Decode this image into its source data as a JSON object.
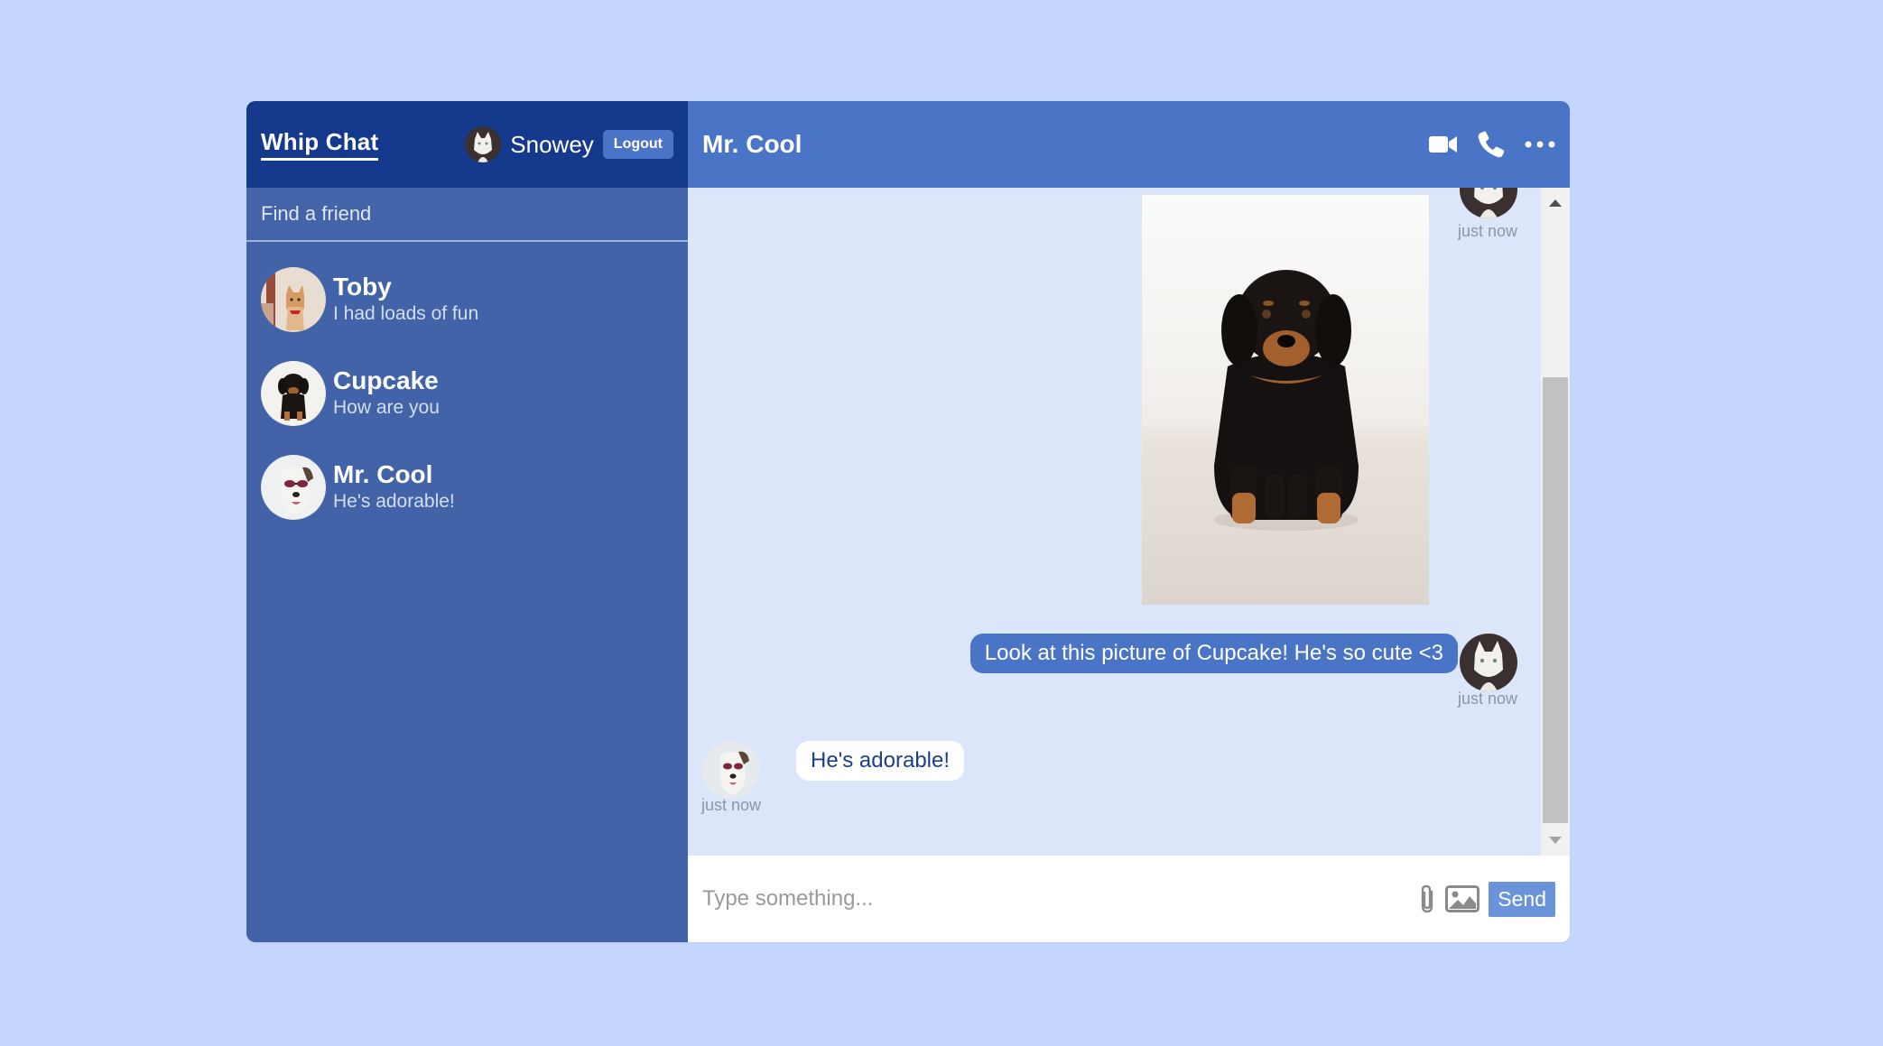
{
  "app": {
    "brand": "Whip Chat"
  },
  "user": {
    "name": "Snowey",
    "logout_label": "Logout"
  },
  "search": {
    "placeholder": "Find a friend"
  },
  "friends": [
    {
      "name": "Toby",
      "last_message": "I had loads of fun"
    },
    {
      "name": "Cupcake",
      "last_message": "How are you"
    },
    {
      "name": "Mr. Cool",
      "last_message": "He's adorable!"
    }
  ],
  "chat": {
    "title": "Mr. Cool",
    "messages": [
      {
        "type": "image",
        "time": "just now"
      },
      {
        "type": "text",
        "text": "Look at this picture of Cupcake! He's so cute <3",
        "time": "just now"
      },
      {
        "type": "text",
        "text": "He's adorable!",
        "time": "just now"
      }
    ]
  },
  "composer": {
    "placeholder": "Type something...",
    "send_label": "Send"
  },
  "colors": {
    "page_bg": "#c5d6fd",
    "sidebar": "#4263a7",
    "sidebar_header": "#15398c",
    "accent": "#4a74c6",
    "chat_bg": "#dce6fb"
  }
}
